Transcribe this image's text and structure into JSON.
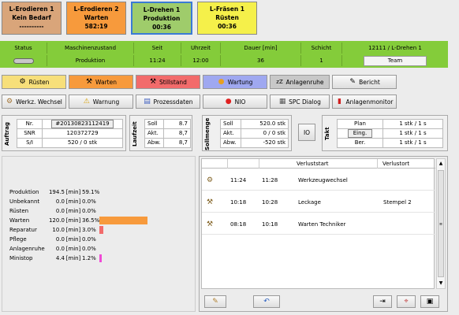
{
  "machine_tabs": [
    {
      "name": "L-Erodieren 1",
      "state": "Kein Bedarf",
      "time": "----------",
      "bg": "#d9a57a"
    },
    {
      "name": "L-Erodieren 2",
      "state": "Warten",
      "time": "582:19",
      "bg": "#f79a3c"
    },
    {
      "name": "L-Drehen 1",
      "state": "Produktion",
      "time": "00:36",
      "bg": "#9fcc6b"
    },
    {
      "name": "L-Fräsen 1",
      "state": "Rüsten",
      "time": "00:36",
      "bg": "#f5f04a"
    }
  ],
  "status_header": {
    "status": "Status",
    "maschinenzustand": "Maschinenzustand",
    "seit": "Seit",
    "uhrzeit": "Uhrzeit",
    "dauer": "Dauer [min]",
    "schicht": "Schicht",
    "machine_id": "12111  / L-Drehen 1"
  },
  "status_values": {
    "zustand": "Produktion",
    "seit": "11:24",
    "uhrzeit": "12:00",
    "dauer": "36",
    "schicht": "1",
    "team_label": "Team"
  },
  "buttons_row1": [
    {
      "label": "Rüsten",
      "icon": "wrench-icon",
      "glyph": "⚙",
      "bg": "#f7df7a"
    },
    {
      "label": "Warten",
      "icon": "tools-icon",
      "glyph": "⚒",
      "bg": "#f79a3c"
    },
    {
      "label": "Stillstand",
      "icon": "stillstand-icon",
      "glyph": "⚒",
      "bg": "#f26b6b"
    },
    {
      "label": "Wartung",
      "icon": "drop-icon",
      "glyph": "●",
      "bg": "#9fa8f0"
    },
    {
      "label": "Anlagenruhe",
      "icon": "sleep-icon",
      "glyph": "zZ",
      "bg": "#c8c8c8"
    },
    {
      "label": "Bericht",
      "icon": "report-icon",
      "glyph": "✎",
      "bg": "#e4e4e4"
    }
  ],
  "buttons_row2": [
    {
      "label": "Werkz. Wechsel",
      "icon": "tool-change-icon",
      "glyph": "⚙"
    },
    {
      "label": "Warnung",
      "icon": "warning-icon",
      "glyph": "⚠"
    },
    {
      "label": "Prozessdaten",
      "icon": "chart-icon",
      "glyph": "▤"
    },
    {
      "label": "NIO",
      "icon": "nio-icon",
      "glyph": "●"
    },
    {
      "label": "SPC Dialog",
      "icon": "spc-icon",
      "glyph": "▦"
    },
    {
      "label": "Anlagenmonitor",
      "icon": "thermometer-icon",
      "glyph": "▮"
    }
  ],
  "auftrag": {
    "title": "Auftrag",
    "rows": [
      {
        "label": "Nr.",
        "value": "#20130823112419"
      },
      {
        "label": "SNR",
        "value": "120372729"
      },
      {
        "label": "S/I",
        "value": "520  / 0 stk"
      }
    ]
  },
  "laufzeit": {
    "title": "Laufzeit",
    "rows": [
      {
        "label": "Soll",
        "value": "8.7"
      },
      {
        "label": "Akt.",
        "value": "8,7"
      },
      {
        "label": "Abw.",
        "value": "8,7"
      }
    ]
  },
  "sollmenge": {
    "title": "Sollmenge",
    "rows": [
      {
        "label": "Soll",
        "value": "520.0 stk"
      },
      {
        "label": "Akt.",
        "value": "0  / 0 stk"
      },
      {
        "label": "Abw.",
        "value": "-520 stk"
      }
    ]
  },
  "io_label": "IO",
  "takt": {
    "title": "Takt",
    "rows": [
      {
        "label": "Plan",
        "value": "1 stk / 1 s"
      },
      {
        "label": "Eing.",
        "value": "1 stk / 1 s"
      },
      {
        "label": "Ber.",
        "value": "1 stk / 1 s"
      }
    ]
  },
  "stats": [
    {
      "label": "Produktion",
      "min": "194.5",
      "pct": "59.1%",
      "fraction": 0,
      "color": "#f79a3c"
    },
    {
      "label": "Unbekannt",
      "min": "0.0",
      "pct": "0.0%",
      "fraction": 0,
      "color": "#999999"
    },
    {
      "label": "Rüsten",
      "min": "0.0",
      "pct": "0.0%",
      "fraction": 0,
      "color": "#f5f04a"
    },
    {
      "label": "Warten",
      "min": "120.0",
      "pct": "36.5%",
      "fraction": 0.365,
      "color": "#f79a3c"
    },
    {
      "label": "Reparatur",
      "min": "10.0",
      "pct": "3.0%",
      "fraction": 0.03,
      "color": "#f26b6b"
    },
    {
      "label": "Pflege",
      "min": "0.0",
      "pct": "0.0%",
      "fraction": 0,
      "color": "#9fa8f0"
    },
    {
      "label": "Anlagenruhe",
      "min": "0.0",
      "pct": "0.0%",
      "fraction": 0,
      "color": "#c8c8c8"
    },
    {
      "label": "Ministop",
      "min": "4.4",
      "pct": "1.2%",
      "fraction": 0.012,
      "color": "#f04ad6"
    }
  ],
  "stats_unit": "[min]",
  "verlust": {
    "headers": {
      "start": "Verluststart",
      "ort": "Verlustort"
    },
    "rows": [
      {
        "icon": "tool-change-icon",
        "glyph": "⚙",
        "start": "11:24",
        "end": "11:28",
        "type": "Werkzeugwechsel",
        "ort": ""
      },
      {
        "icon": "tools-icon",
        "glyph": "⚒",
        "start": "10:18",
        "end": "10:28",
        "type": "Leckage",
        "ort": "Stempel 2"
      },
      {
        "icon": "wait-icon",
        "glyph": "⚒",
        "start": "08:18",
        "end": "10:18",
        "type": "Warten Techniker",
        "ort": ""
      }
    ]
  },
  "bottom_icons": [
    "edit-icon",
    "undo-icon",
    "export-icon",
    "map-icon",
    "window-icon"
  ]
}
